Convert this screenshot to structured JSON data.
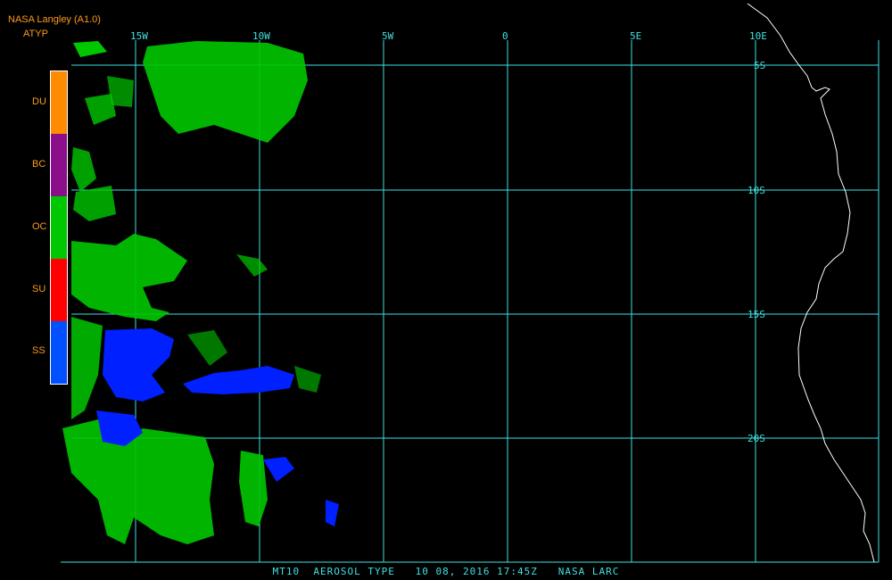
{
  "header": {
    "source": "NASA Langley (A1.0)",
    "product": "ATYP"
  },
  "legend": [
    {
      "label": "DU",
      "color": "#ff8c00"
    },
    {
      "label": "BC",
      "color": "#8b0f8b"
    },
    {
      "label": "OC",
      "color": "#00c800"
    },
    {
      "label": "SU",
      "color": "#ff0000"
    },
    {
      "label": "SS",
      "color": "#0050ff"
    }
  ],
  "map": {
    "lon_labels": [
      "15W",
      "10W",
      "5W",
      "0",
      "5E",
      "10E"
    ],
    "lat_labels": [
      "5S",
      "10S",
      "15S",
      "20S"
    ],
    "grid_color": "#40e0e0",
    "coast_color": "#ffffff"
  },
  "footer": {
    "text": "MT10  AEROSOL TYPE   10 08, 2016 17:45Z   NASA LARC"
  }
}
